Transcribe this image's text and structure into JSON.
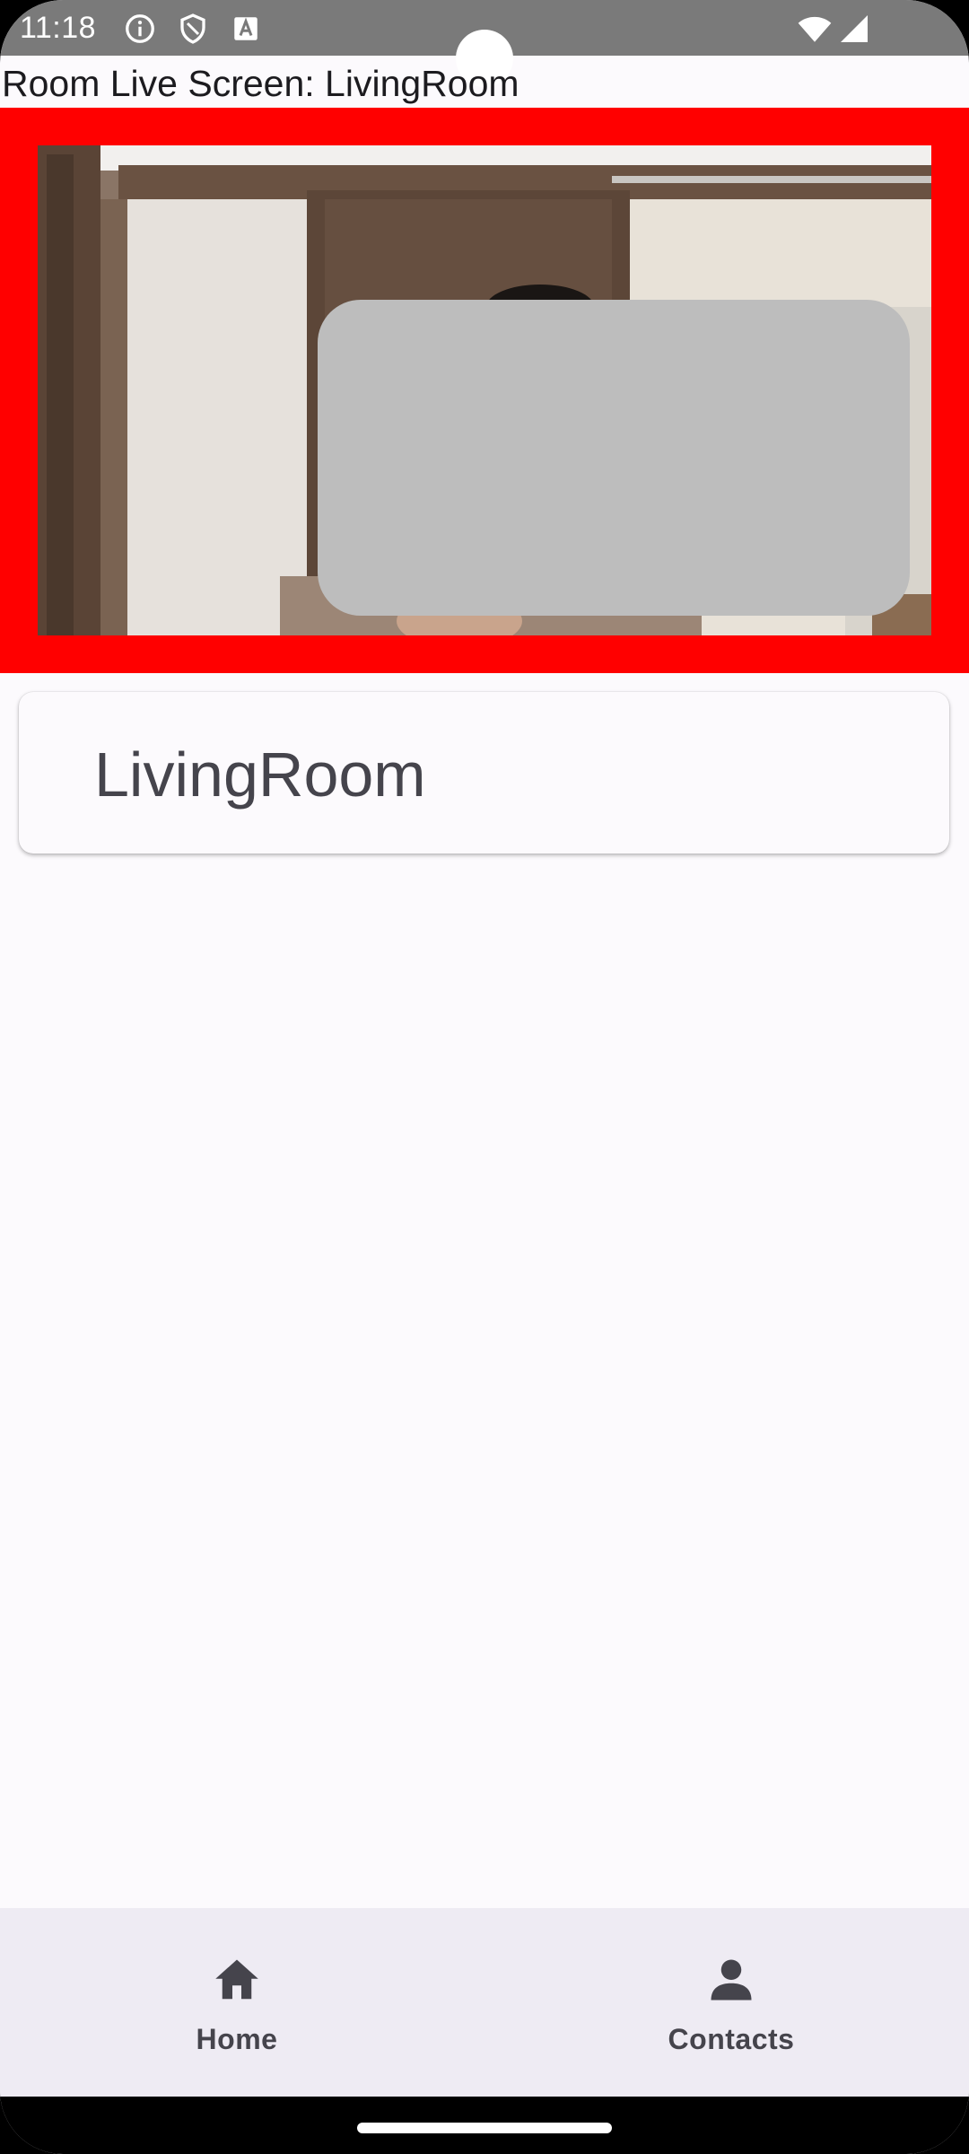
{
  "status_bar": {
    "time": "11:18",
    "icons": [
      "info-icon",
      "shield-icon",
      "keyboard-a-icon",
      "wifi-icon",
      "cell-signal-icon"
    ]
  },
  "screen": {
    "title": "Room Live Screen: LivingRoom",
    "frame_color": "#ff0000"
  },
  "room_card": {
    "label": "LivingRoom"
  },
  "bottom_nav": {
    "items": [
      {
        "label": "Home",
        "icon": "home-icon"
      },
      {
        "label": "Contacts",
        "icon": "person-icon"
      }
    ]
  }
}
